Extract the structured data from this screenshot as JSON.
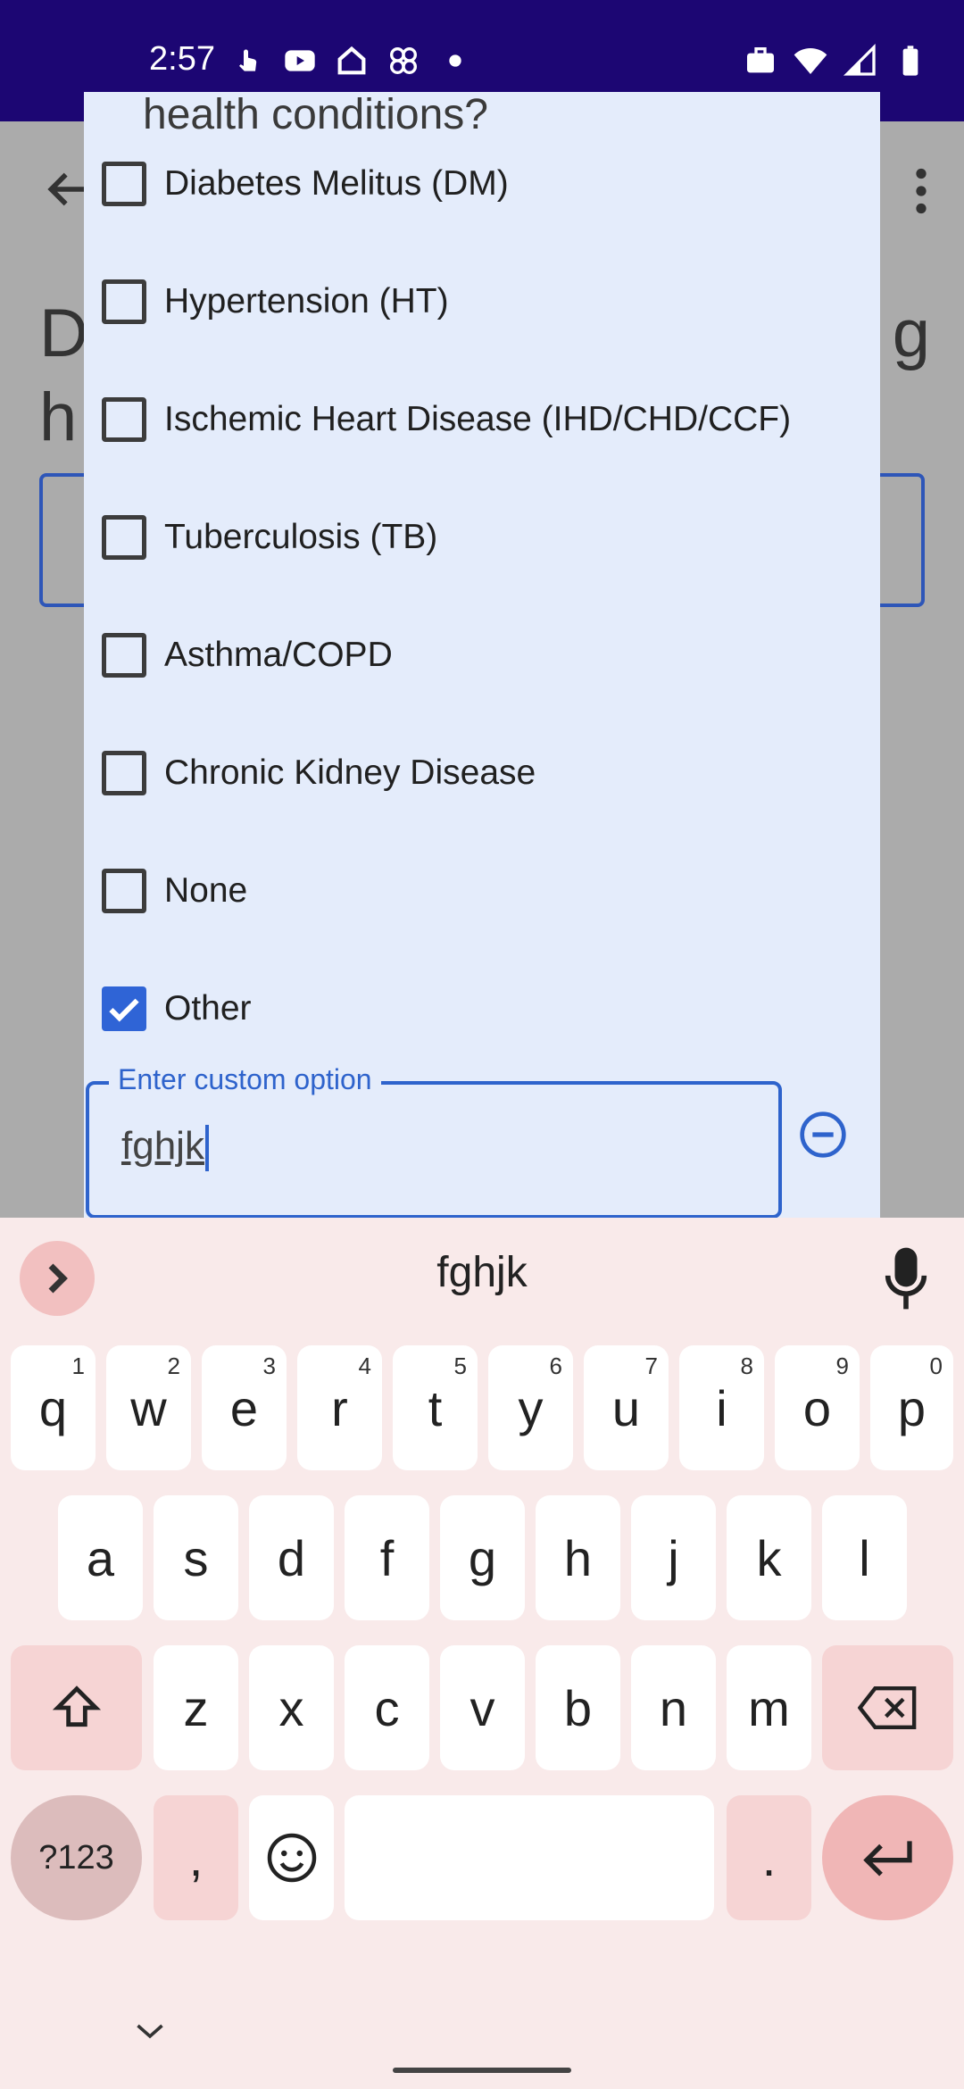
{
  "status_bar": {
    "time": "2:57",
    "left_icons": [
      "touch-icon",
      "youtube-icon",
      "home-icon",
      "pinwheel-icon",
      "dot-icon"
    ],
    "right_icons": [
      "briefcase-icon",
      "wifi-icon",
      "signal-icon",
      "battery-icon"
    ]
  },
  "background_page": {
    "heading_line1_start": "D",
    "heading_line1_end": "g",
    "heading_line2_start": "h"
  },
  "dialog": {
    "title": "health conditions?",
    "options": [
      {
        "label": "Diabetes Melitus (DM)",
        "checked": false
      },
      {
        "label": "Hypertension (HT)",
        "checked": false
      },
      {
        "label": "Ischemic Heart Disease (IHD/CHD/CCF)",
        "checked": false
      },
      {
        "label": "Tuberculosis (TB)",
        "checked": false
      },
      {
        "label": "Asthma/COPD",
        "checked": false
      },
      {
        "label": "Chronic Kidney Disease",
        "checked": false
      },
      {
        "label": "None",
        "checked": false
      },
      {
        "label": "Other",
        "checked": true
      }
    ],
    "custom_option": {
      "label": "Enter custom option",
      "value": "fghjk"
    }
  },
  "keyboard": {
    "suggestion": "fghjk",
    "row1": [
      {
        "key": "q",
        "hint": "1"
      },
      {
        "key": "w",
        "hint": "2"
      },
      {
        "key": "e",
        "hint": "3"
      },
      {
        "key": "r",
        "hint": "4"
      },
      {
        "key": "t",
        "hint": "5"
      },
      {
        "key": "y",
        "hint": "6"
      },
      {
        "key": "u",
        "hint": "7"
      },
      {
        "key": "i",
        "hint": "8"
      },
      {
        "key": "o",
        "hint": "9"
      },
      {
        "key": "p",
        "hint": "0"
      }
    ],
    "row2": [
      "a",
      "s",
      "d",
      "f",
      "g",
      "h",
      "j",
      "k",
      "l"
    ],
    "row3": [
      "z",
      "x",
      "c",
      "v",
      "b",
      "n",
      "m"
    ],
    "symbols_label": "?123",
    "comma_label": ",",
    "period_label": "."
  },
  "colors": {
    "status_bar": "#1c0673",
    "dialog_bg": "#e4ecfb",
    "accent": "#2f64d6",
    "keyboard_bg": "#f9eaea"
  }
}
